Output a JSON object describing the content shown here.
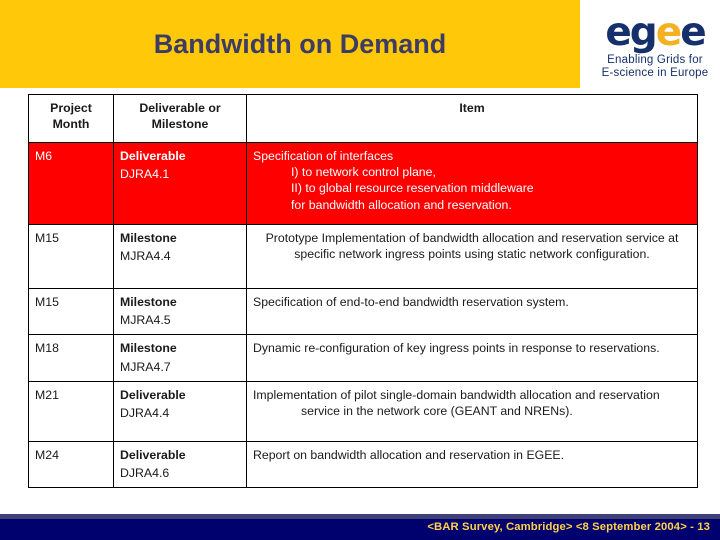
{
  "slide": {
    "title": "Bandwidth on Demand",
    "banner_color": "#ffc809",
    "title_color": "#3c3c64"
  },
  "logo": {
    "name": "egee-logo",
    "word_part_1": "eg",
    "word_part_gold": "e",
    "word_part_2": "e",
    "tagline_line_1": "Enabling Grids for",
    "tagline_line_2": "E-science in Europe",
    "primary_color": "#16306b",
    "accent_color": "#f4b223"
  },
  "table": {
    "headers": {
      "month": "Project\nMonth",
      "month_line_1": "Project",
      "month_line_2": "Month",
      "type_line_1": "Deliverable or",
      "type_line_2": "Milestone",
      "item": "Item"
    },
    "highlight_color": "#fe0000",
    "rows": [
      {
        "month": "M6",
        "type": "Deliverable",
        "code": "DJRA4.1",
        "item": "Specification of interfaces\nI)    to network control plane,\nII)   to global resource reservation middleware\nfor bandwidth allocation and reservation.",
        "highlighted": true
      },
      {
        "month": "M15",
        "type": "Milestone",
        "code": "MJRA4.4",
        "item": "Prototype Implementation of bandwidth allocation and reservation service at specific network ingress points using static network configuration.",
        "highlighted": false
      },
      {
        "month": "M15",
        "type": "Milestone",
        "code": "MJRA4.5",
        "item": "Specification of end-to-end bandwidth reservation system.",
        "highlighted": false
      },
      {
        "month": "M18",
        "type": "Milestone",
        "code": "MJRA4.7",
        "item": "Dynamic re-configuration of key ingress points in response to reservations.",
        "highlighted": false
      },
      {
        "month": "M21",
        "type": "Deliverable",
        "code": "DJRA4.4",
        "item": "Implementation of pilot single-domain bandwidth allocation and reservation service in the network core (GEANT and NRENs).",
        "highlighted": false
      },
      {
        "month": "M24",
        "type": "Deliverable",
        "code": "DJRA4.6",
        "item": "Report on bandwidth allocation and reservation in EGEE.",
        "highlighted": false
      }
    ]
  },
  "footer": {
    "text": "<BAR Survey, Cambridge> <8 September 2004>  - 13",
    "bar_color": "#00006e",
    "text_color": "#ffd24a"
  }
}
